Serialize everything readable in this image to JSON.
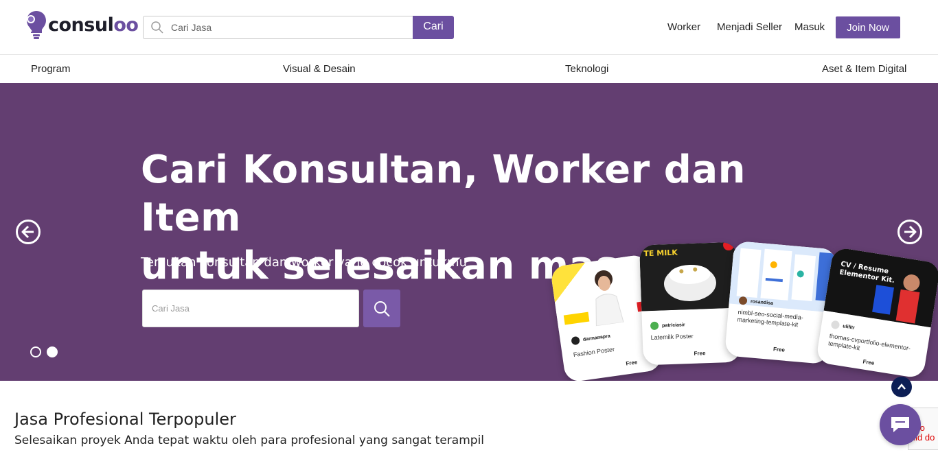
{
  "brand": {
    "name_prefix": "consul",
    "name_suffix": "oo",
    "primary": "#6b4fa0",
    "hero_bg": "#633e71"
  },
  "header": {
    "search_placeholder": "Cari Jasa",
    "search_button": "Cari",
    "nav": {
      "worker": "Worker",
      "seller": "Menjadi Seller",
      "login": "Masuk",
      "join": "Join Now"
    }
  },
  "categories": [
    "Program",
    "Visual & Desain",
    "Teknologi",
    "Aset & Item Digital"
  ],
  "hero": {
    "title_line1": "Cari Konsultan, Worker dan Item",
    "title_line2": "untuk selesaikan masalahmu",
    "subtitle": "Temukan konsultan dan worker yang cocok untukmu",
    "search_placeholder": "Cari Jasa",
    "slides": 2,
    "active_slide": 2
  },
  "cards": [
    {
      "author": "darmanapra",
      "title": "Fashion Poster",
      "price": "Free"
    },
    {
      "author": "patriciasir",
      "title": "Latemilk Poster",
      "price": "Free"
    },
    {
      "author": "rosandisa",
      "title": "nimbl-seo-social-media-marketing-template-kit",
      "price": "Free"
    },
    {
      "author": "ulifitr",
      "title": "thomas-cvportfolio-elementor-template-kit",
      "price": "Free"
    }
  ],
  "section": {
    "title": "Jasa Profesional Terpopuler",
    "subtitle": "Selesaikan proyek Anda tepat waktu oleh para profesional yang sangat terampil"
  },
  "recaptcha_text": {
    "line1": "R fo",
    "line2": "alid do"
  },
  "icons": [
    "logo-bulb-icon",
    "search-icon",
    "arrow-left-icon",
    "arrow-right-icon",
    "chevron-up-icon",
    "chat-icon"
  ]
}
